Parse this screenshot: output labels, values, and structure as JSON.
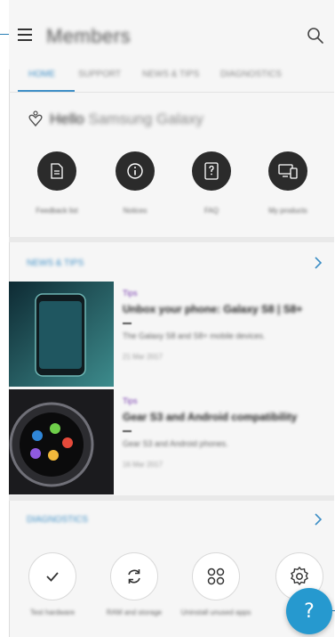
{
  "app_title": "Members",
  "tabs": [
    "HOME",
    "SUPPORT",
    "NEWS & TIPS",
    "DIAGNOSTICS"
  ],
  "greeting": "Hello",
  "greeting_name": "Samsung Galaxy",
  "quick_actions": [
    {
      "label": "Feedback list",
      "icon": "document-icon"
    },
    {
      "label": "Notices",
      "icon": "info-icon"
    },
    {
      "label": "FAQ",
      "icon": "faq-icon"
    },
    {
      "label": "My products",
      "icon": "devices-icon"
    }
  ],
  "news_section": {
    "title": "NEWS & TIPS",
    "items": [
      {
        "tag": "Tips",
        "title": "Unbox your phone: Galaxy S8 | S8+",
        "description": "The Galaxy S8 and S8+ mobile devices.",
        "date": "21 Mar 2017",
        "thumb": "phone"
      },
      {
        "tag": "Tips",
        "title": "Gear S3 and Android compatibility",
        "description": "Gear S3 and Android phones.",
        "date": "16 Mar 2017",
        "thumb": "watch"
      }
    ]
  },
  "diagnostics_section": {
    "title": "DIAGNOSTICS",
    "items": [
      {
        "label": "Test hardware",
        "icon": "check-icon"
      },
      {
        "label": "RAM and storage",
        "icon": "refresh-icon"
      },
      {
        "label": "Uninstall unused apps",
        "icon": "apps-grid-icon"
      },
      {
        "label": "Settings",
        "icon": "gear-icon"
      }
    ]
  },
  "fab": {
    "glyph": "?"
  },
  "colors": {
    "accent": "#3e8fc6",
    "fab": "#2699cf",
    "quick_bg": "#2b2b2b",
    "tag": "#7a3fb0"
  }
}
